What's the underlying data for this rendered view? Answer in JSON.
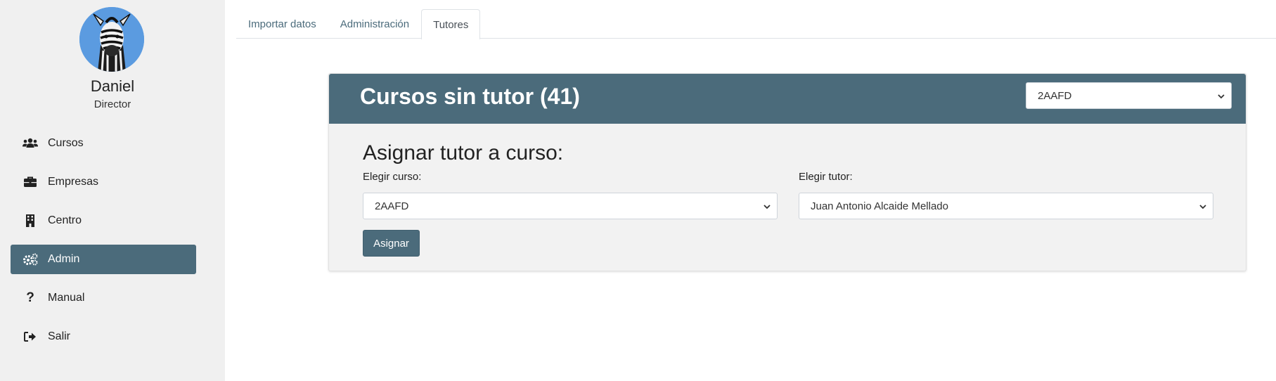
{
  "user": {
    "name": "Daniel",
    "role": "Director"
  },
  "sidebar": {
    "items": [
      {
        "label": "Cursos",
        "icon": "users-icon",
        "active": false
      },
      {
        "label": "Empresas",
        "icon": "briefcase-icon",
        "active": false
      },
      {
        "label": "Centro",
        "icon": "building-icon",
        "active": false
      },
      {
        "label": "Admin",
        "icon": "cogs-icon",
        "active": true
      },
      {
        "label": "Manual",
        "icon": "question-icon",
        "active": false
      },
      {
        "label": "Salir",
        "icon": "sign-out-icon",
        "active": false
      }
    ]
  },
  "tabs": [
    {
      "label": "Importar datos",
      "active": false
    },
    {
      "label": "Administración",
      "active": false
    },
    {
      "label": "Tutores",
      "active": true
    }
  ],
  "card": {
    "title": "Cursos sin tutor (41)",
    "header_select_value": "2AAFD",
    "form_title": "Asignar tutor a curso:",
    "course_label": "Elegir curso:",
    "course_value": "2AAFD",
    "tutor_label": "Elegir tutor:",
    "tutor_value": "Juan Antonio Alcaide Mellado",
    "assign_label": "Asignar"
  },
  "colors": {
    "accent": "#4b6b7b",
    "sidebar_bg": "#f0f0f0",
    "card_bg": "#f2f2f2"
  }
}
